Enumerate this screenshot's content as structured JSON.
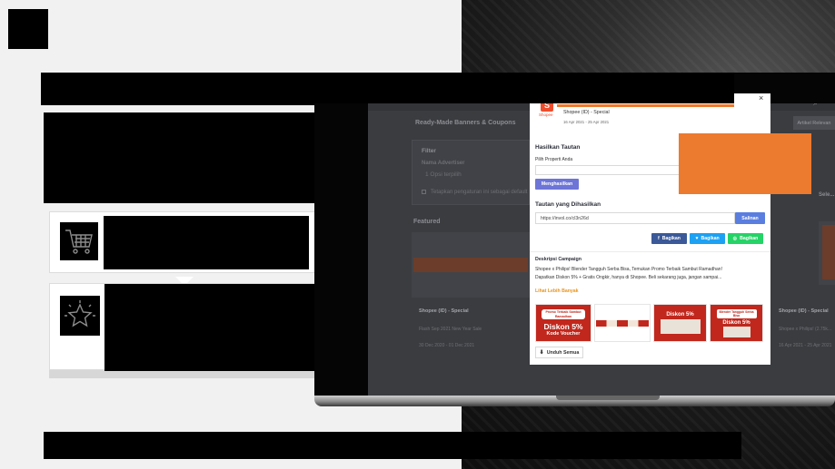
{
  "colors": {
    "accent_orange": "#ec7a2f",
    "button_purple": "#6d75d7",
    "facebook_blue": "#3b5998",
    "twitter_blue": "#1da1f2",
    "whatsapp_green": "#25d366",
    "copy_blue": "#5a7ee0",
    "link_orange": "#e89520"
  },
  "left_panel": {
    "card_icons": [
      "shopping-cart-icon",
      "star-icon"
    ]
  },
  "screen": {
    "page_title": "Ready-Made Banners & Coupons",
    "filter_title": "Filter",
    "advertiser_label": "Nama Advertiser",
    "advertiser_select": "1 Opsi terpilih",
    "default_filter_checkbox": "Tetapkan pengaturan ini sebagai default",
    "featured_heading": "Featured",
    "right_button": "Artikel Relevan",
    "select_all": "Sele..."
  },
  "cards": [
    {
      "title": "Shopee (ID) - Special",
      "subtitle": "Flash Sep 2021 New Year Sale",
      "date": "30 Dec 2020 - 01 Dec 2021"
    },
    {
      "title": "Shopee (ID) - Special",
      "subtitle": "Shopee x Philips! (2.75k...",
      "date": "16 Apr 2021 - 25 Apr 2021"
    }
  ],
  "modal": {
    "brand": "Shopee",
    "title": "Shopee (ID) - Special",
    "date_range": "16 Apr 2021 - 25 Apr 2021",
    "close_symbol": "×",
    "generate_section_heading": "Hasilkan Tautan",
    "property_label": "Pilih Properti Anda",
    "property_value": "",
    "generate_button": "Menghasilkan",
    "result_heading": "Tautan yang Dihasilkan",
    "result_link": "https://invol.co/cl3n26d",
    "copy_button": "Salinan",
    "share_buttons": [
      "Bagikan",
      "Bagikan",
      "Bagikan"
    ],
    "share_icons": [
      "f",
      "♥",
      "◎"
    ],
    "description_heading": "Deskripsi Campaign",
    "description_text": [
      "Shopee x Philips! Blender Tangguh Serba Bisa, Temukan Promo Terbaik Sambut Ramadhan!",
      "Dapatkan Diskon 5% + Gratis Ongkir, hanya di Shopee. Beli sekarang juga, jangan sampai..."
    ],
    "see_more": "Lihat Lebih Banyak",
    "download_button": "Unduh Semua",
    "download_icon": "download-icon",
    "thumbnails": [
      {
        "caption": "Promo Terbaik Sambut Ramadhan",
        "headline": "Diskon 5%",
        "sub": "Kode Voucher"
      },
      {
        "caption": "",
        "headline": "",
        "sub": ""
      },
      {
        "caption": "",
        "headline": "Diskon 5%",
        "sub": ""
      },
      {
        "caption": "Blender Tangguh Serba Bisa",
        "headline": "Diskon 5%",
        "sub": ""
      }
    ]
  }
}
